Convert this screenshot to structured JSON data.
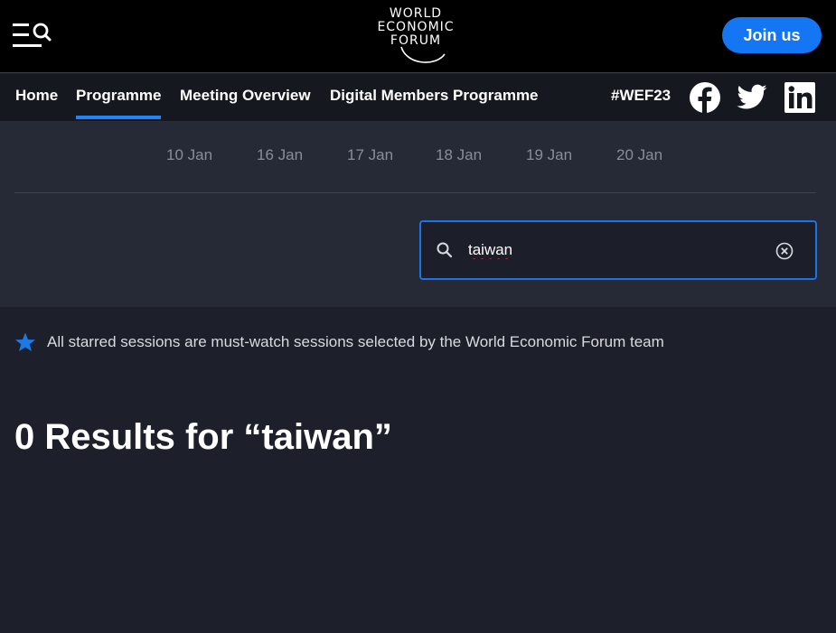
{
  "header": {
    "logo_lines": [
      "WORLD",
      "ECONOMIC",
      "FORUM"
    ],
    "join_label": "Join us",
    "menu_icon": "menu-search-icon"
  },
  "nav": {
    "items": [
      {
        "label": "Home",
        "active": false
      },
      {
        "label": "Programme",
        "active": true
      },
      {
        "label": "Meeting Overview",
        "active": false
      },
      {
        "label": "Digital Members Programme",
        "active": false
      }
    ],
    "hashtag": "#WEF23",
    "social": [
      "facebook-icon",
      "twitter-icon",
      "linkedin-icon"
    ]
  },
  "dates": [
    "10 Jan",
    "16 Jan",
    "17 Jan",
    "18 Jan",
    "19 Jan",
    "20 Jan"
  ],
  "search": {
    "value": "taiwan",
    "icon": "search-icon",
    "clear_icon": "clear-icon"
  },
  "note": {
    "text": "All starred sessions are must-watch sessions selected by the World Economic Forum team",
    "icon": "star-icon"
  },
  "results": {
    "title": "0 Results for “taiwan”"
  },
  "colors": {
    "accent": "#1476f2",
    "header_bg": "#000000",
    "page_bg": "#1d202a",
    "filter_bg": "#262a36",
    "date_text": "#8a8d96"
  }
}
